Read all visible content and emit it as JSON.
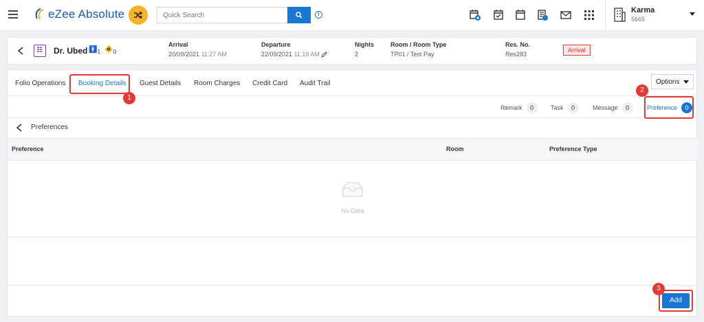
{
  "topbar": {
    "brand": "eZee Absolute",
    "search_placeholder": "Quick Search",
    "user": {
      "name": "Karma",
      "id": "5665"
    }
  },
  "reservation": {
    "guest_name": "Dr. Ubed",
    "adults": "1",
    "children": "0",
    "arrival_label": "Arrival",
    "arrival_date": "20/09/2021",
    "arrival_time": "11:27 AM",
    "departure_label": "Departure",
    "departure_date": "22/09/2021",
    "departure_time": "11:19 AM",
    "nights_label": "Nights",
    "nights": "2",
    "room_label": "Room / Room Type",
    "room": "TP01 / Test Pay",
    "resno_label": "Res. No.",
    "resno": "Res283",
    "status": "Arrival",
    "status_color": "#d32f2f"
  },
  "tabs": [
    {
      "label": "Folio Operations"
    },
    {
      "label": "Booking Details"
    },
    {
      "label": "Guest Details"
    },
    {
      "label": "Room Charges"
    },
    {
      "label": "Credit Card"
    },
    {
      "label": "Audit Trail"
    }
  ],
  "options_label": "Options",
  "counters": [
    {
      "label": "Remark",
      "count": "0"
    },
    {
      "label": "Task",
      "count": "0"
    },
    {
      "label": "Message",
      "count": "0"
    },
    {
      "label": "Preference",
      "count": "0"
    }
  ],
  "preferences": {
    "title": "Preferences",
    "columns": [
      "Preference",
      "Room",
      "Preference Type"
    ],
    "empty_text": "No Data",
    "add_label": "Add"
  },
  "annotations": [
    "1",
    "2",
    "3"
  ],
  "colors": {
    "accent": "#1976d2",
    "highlight": "#e53935",
    "logo": "#1a5aa8",
    "shuffle": "#f6b325"
  }
}
